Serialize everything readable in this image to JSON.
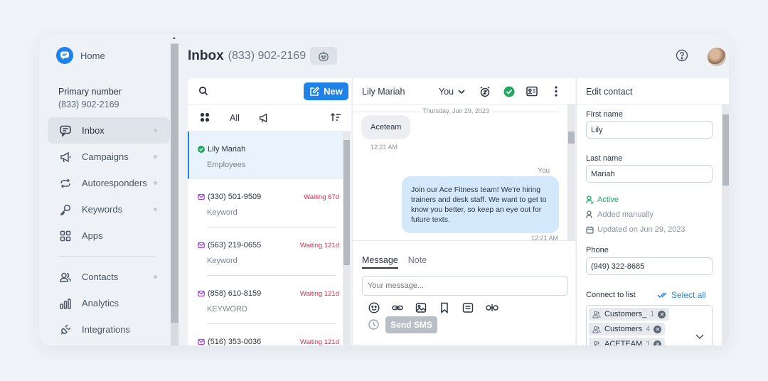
{
  "sidebar": {
    "home_label": "Home",
    "primary_title": "Primary number",
    "primary_number": "(833) 902-2169",
    "items": [
      {
        "label": "Inbox",
        "icon": "chat-icon"
      },
      {
        "label": "Campaigns",
        "icon": "megaphone-icon"
      },
      {
        "label": "Autoresponders",
        "icon": "repeat-icon"
      },
      {
        "label": "Keywords",
        "icon": "key-icon"
      },
      {
        "label": "Apps",
        "icon": "grid-icon"
      },
      {
        "label": "Contacts",
        "icon": "contacts-icon"
      },
      {
        "label": "Analytics",
        "icon": "bar-chart-icon"
      },
      {
        "label": "Integrations",
        "icon": "plug-icon"
      }
    ]
  },
  "header": {
    "title": "Inbox",
    "phone": "(833) 902-2169"
  },
  "list": {
    "new_label": "New",
    "filter_all": "All",
    "conversations": [
      {
        "name": "Lily Mariah",
        "tag": "Employees",
        "wait": ""
      },
      {
        "name": "(330) 501-9509",
        "tag": "Keyword",
        "wait": "Waiting 67d"
      },
      {
        "name": "(563) 219-0655",
        "tag": "Keyword",
        "wait": "Waiting 121d"
      },
      {
        "name": "(858) 610-8159",
        "tag": "KEYWORD",
        "wait": "Waiting 121d"
      },
      {
        "name": "(516) 353-0036",
        "tag": "",
        "wait": "Waiting 121d"
      }
    ]
  },
  "chat": {
    "contact_name": "Lily Mariah",
    "assignee": "You",
    "date": "Thursday, Jun 29, 2023",
    "incoming_text": "Aceteam",
    "incoming_time": "12:21 AM",
    "outgoing_sender": "You",
    "outgoing_text": "Join our Ace Fitness team! We're hiring trainers and desk staff. We want to get to know you better, so keep an eye out for future texts.",
    "outgoing_time": "12:21 AM",
    "tab_message": "Message",
    "tab_note": "Note",
    "input_placeholder": "Your message...",
    "send_label": "Send SMS"
  },
  "edit": {
    "title": "Edit contact",
    "first_name_label": "First name",
    "first_name": "Lily",
    "last_name_label": "Last name",
    "last_name": "Mariah",
    "status": "Active",
    "added": "Added manually",
    "updated": "Updated on Jun 29, 2023",
    "phone_label": "Phone",
    "phone": "(949) 322-8685",
    "connect_label": "Connect to list",
    "select_all": "Select all",
    "lists": [
      {
        "name": "Customers_",
        "count": "1"
      },
      {
        "name": "Customers",
        "count": "4"
      },
      {
        "name": "ACETEAM",
        "count": "1"
      }
    ]
  },
  "colors": {
    "accent": "#1e82e8",
    "waiting": "#e0294a",
    "active": "#20a860"
  }
}
